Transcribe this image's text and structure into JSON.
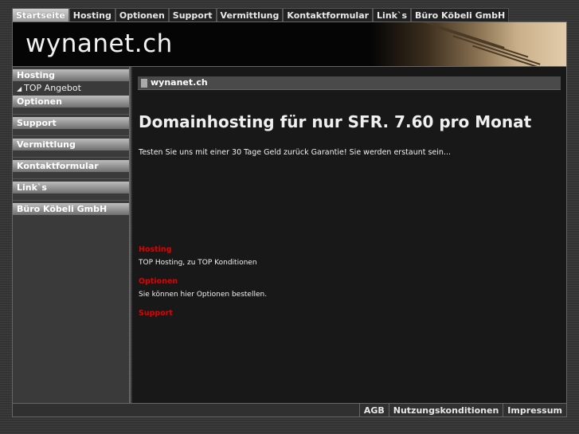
{
  "topnav": {
    "tabs": [
      "Startseite",
      "Hosting",
      "Optionen",
      "Support",
      "Vermittlung",
      "Kontaktformular",
      "Link`s",
      "Büro Köbeli GmbH"
    ]
  },
  "banner": {
    "logo": "wynanet.ch"
  },
  "sidebar": {
    "hosting": "Hosting",
    "top_angebot": "TOP Angebot",
    "optionen": "Optionen",
    "support": "Support",
    "vermittlung": "Vermittlung",
    "kontakt": "Kontaktformular",
    "links": "Link`s",
    "buero": "Büro Köbeli GmbH"
  },
  "content": {
    "header": "wynanet.ch",
    "headline": "Domainhosting für nur SFR. 7.60 pro Monat",
    "intro": "Testen Sie uns mit einer 30 Tage Geld zurück Garantie! Sie werden erstaunt sein...",
    "sections": [
      {
        "title": "Hosting",
        "text": "TOP Hosting, zu TOP Konditionen"
      },
      {
        "title": "Optionen",
        "text": "Sie können hier Optionen bestellen."
      },
      {
        "title": "Support",
        "text": ""
      }
    ]
  },
  "footer": {
    "links": [
      "AGB",
      "Nutzungskonditionen",
      "Impressum"
    ]
  }
}
